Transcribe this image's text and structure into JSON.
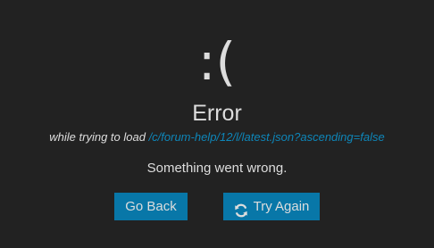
{
  "error": {
    "face": ":(",
    "title": "Error",
    "desc_prefix": "while trying to load ",
    "url": "/c/forum-help/12/l/latest.json?ascending=false",
    "message": "Something went wrong.",
    "back_label": "Go Back",
    "retry_label": "Try Again",
    "retry_icon": "refresh-icon"
  },
  "colors": {
    "background": "#222222",
    "text": "#dddddd",
    "link": "#0e86b9",
    "button": "#0877a8"
  }
}
